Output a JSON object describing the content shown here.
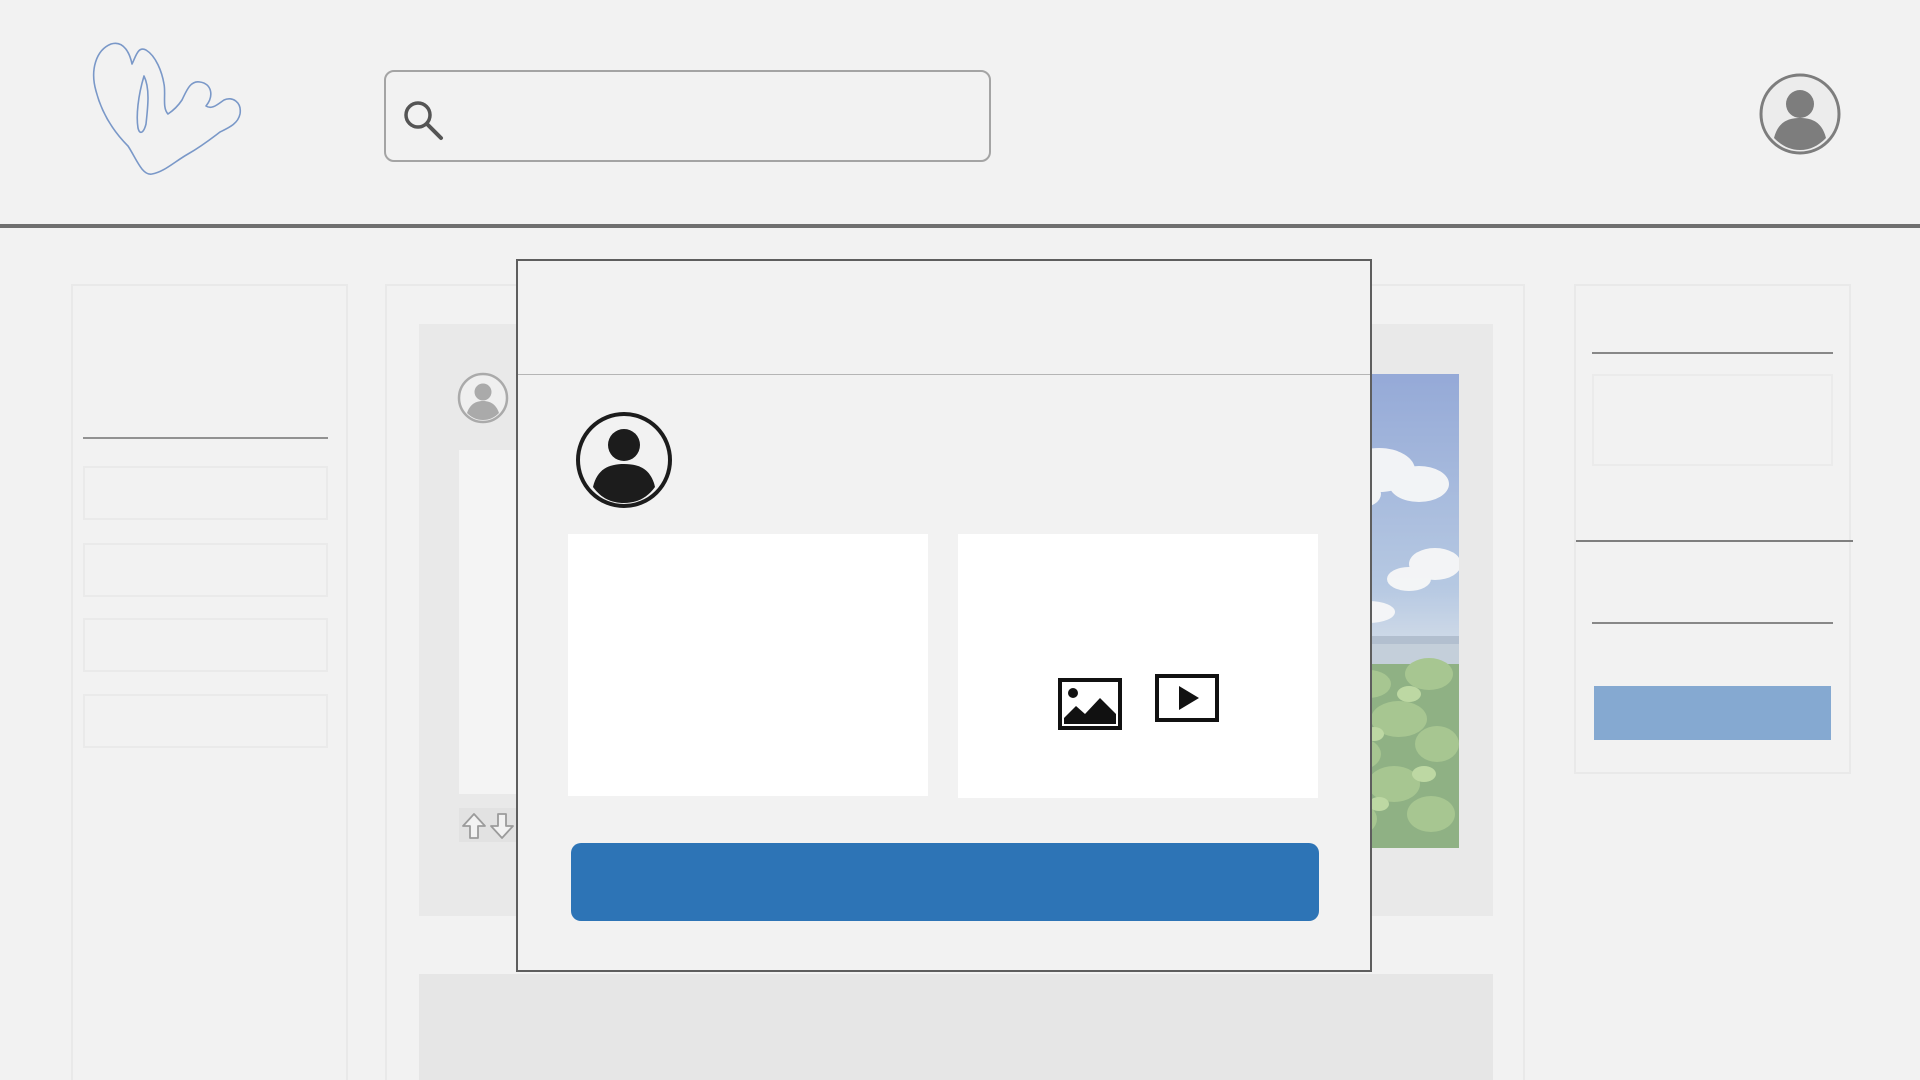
{
  "header": {
    "logo": "blob-logo-outline",
    "search": {
      "icon": "search-icon",
      "placeholder": "",
      "value": ""
    },
    "account_icon": "user-avatar-icon"
  },
  "sidebar_left": {
    "items": [
      "",
      "",
      "",
      ""
    ]
  },
  "feed": {
    "post": {
      "avatar_icon": "user-avatar-icon",
      "text": "",
      "vote_icons": [
        "arrow-up-icon",
        "arrow-down-icon"
      ],
      "image": "sky-clouds-and-green-leaves-photo"
    }
  },
  "sidebar_right": {
    "box_text": "",
    "button_label": ""
  },
  "modal": {
    "title": "",
    "avatar_icon": "user-avatar-icon",
    "text_placeholder": "",
    "media": {
      "image_icon": "image-icon",
      "video_icon": "video-play-icon"
    },
    "submit_label": ""
  },
  "colors": {
    "background": "#f2f2f2",
    "primary_button": "#2d74b6",
    "secondary_button_dimmed": "#8aaed0",
    "logo_stroke": "#7a98c8",
    "header_rule": "#6f6f6f"
  }
}
